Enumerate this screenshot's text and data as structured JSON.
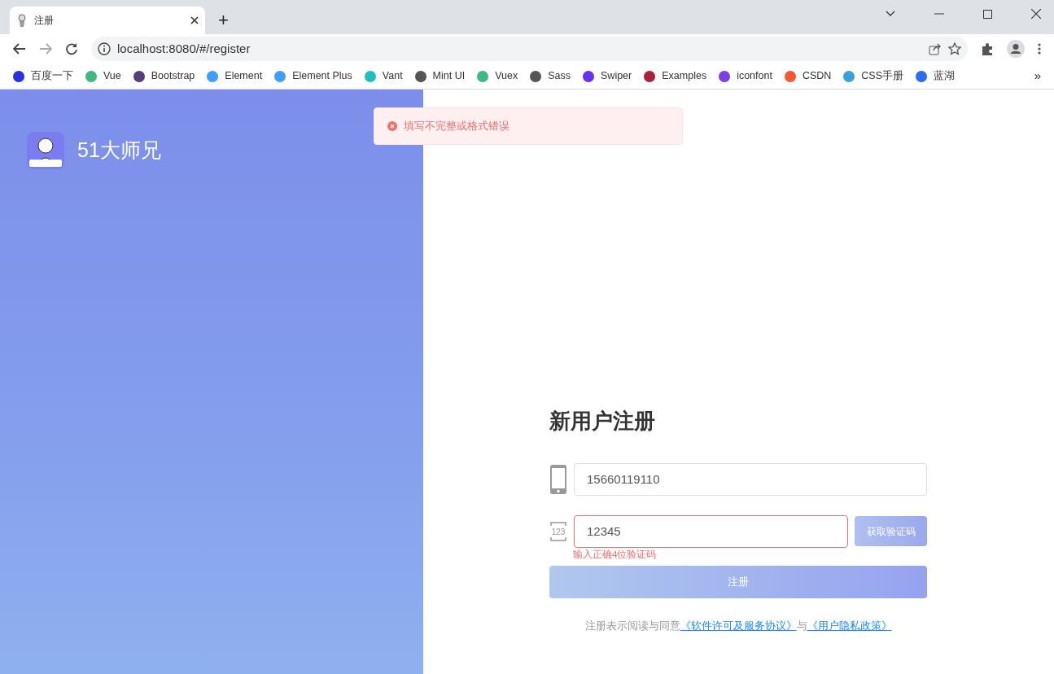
{
  "browser": {
    "tabs": [
      {
        "title": "注册",
        "selected": true
      }
    ],
    "new_tab": "+",
    "url": "localhost:8080/#/register",
    "bookmarks": [
      {
        "label": "百度一下",
        "color": "#2932e1"
      },
      {
        "label": "Vue",
        "color": "#41b883"
      },
      {
        "label": "Bootstrap",
        "color": "#563d7c"
      },
      {
        "label": "Element",
        "color": "#409eff"
      },
      {
        "label": "Element Plus",
        "color": "#409eff"
      },
      {
        "label": "Vant",
        "color": "#1fbfbf"
      },
      {
        "label": "Mint UI",
        "color": "#555555"
      },
      {
        "label": "Vuex",
        "color": "#41b883"
      },
      {
        "label": "Sass",
        "color": "#555555"
      },
      {
        "label": "Swiper",
        "color": "#6332f6"
      },
      {
        "label": "Examples",
        "color": "#a8203a"
      },
      {
        "label": "iconfont",
        "color": "#7b3fe4"
      },
      {
        "label": "CSDN",
        "color": "#fc5531"
      },
      {
        "label": "CSS手册",
        "color": "#3aa1d8"
      },
      {
        "label": "蓝湖",
        "color": "#2b6cf6"
      }
    ],
    "overflow": "»"
  },
  "brand": {
    "name": "51大师兄"
  },
  "toast": {
    "message": "填写不完整或格式错误"
  },
  "form": {
    "title": "新用户注册",
    "phone": {
      "value": "15660119110",
      "error": false
    },
    "code": {
      "icon_text": "123",
      "value": "12345",
      "error": true,
      "error_text": "输入正确4位验证码"
    },
    "get_code_button": {
      "label": "获取验证码",
      "disabled": true
    },
    "register_button": {
      "label": "注册",
      "disabled": true
    },
    "agreement": {
      "text": "注册表示阅读与同意",
      "link_1": "《软件许可及服务协议》",
      "joiner": "与",
      "link_2": "《用户隐私政策》"
    }
  }
}
